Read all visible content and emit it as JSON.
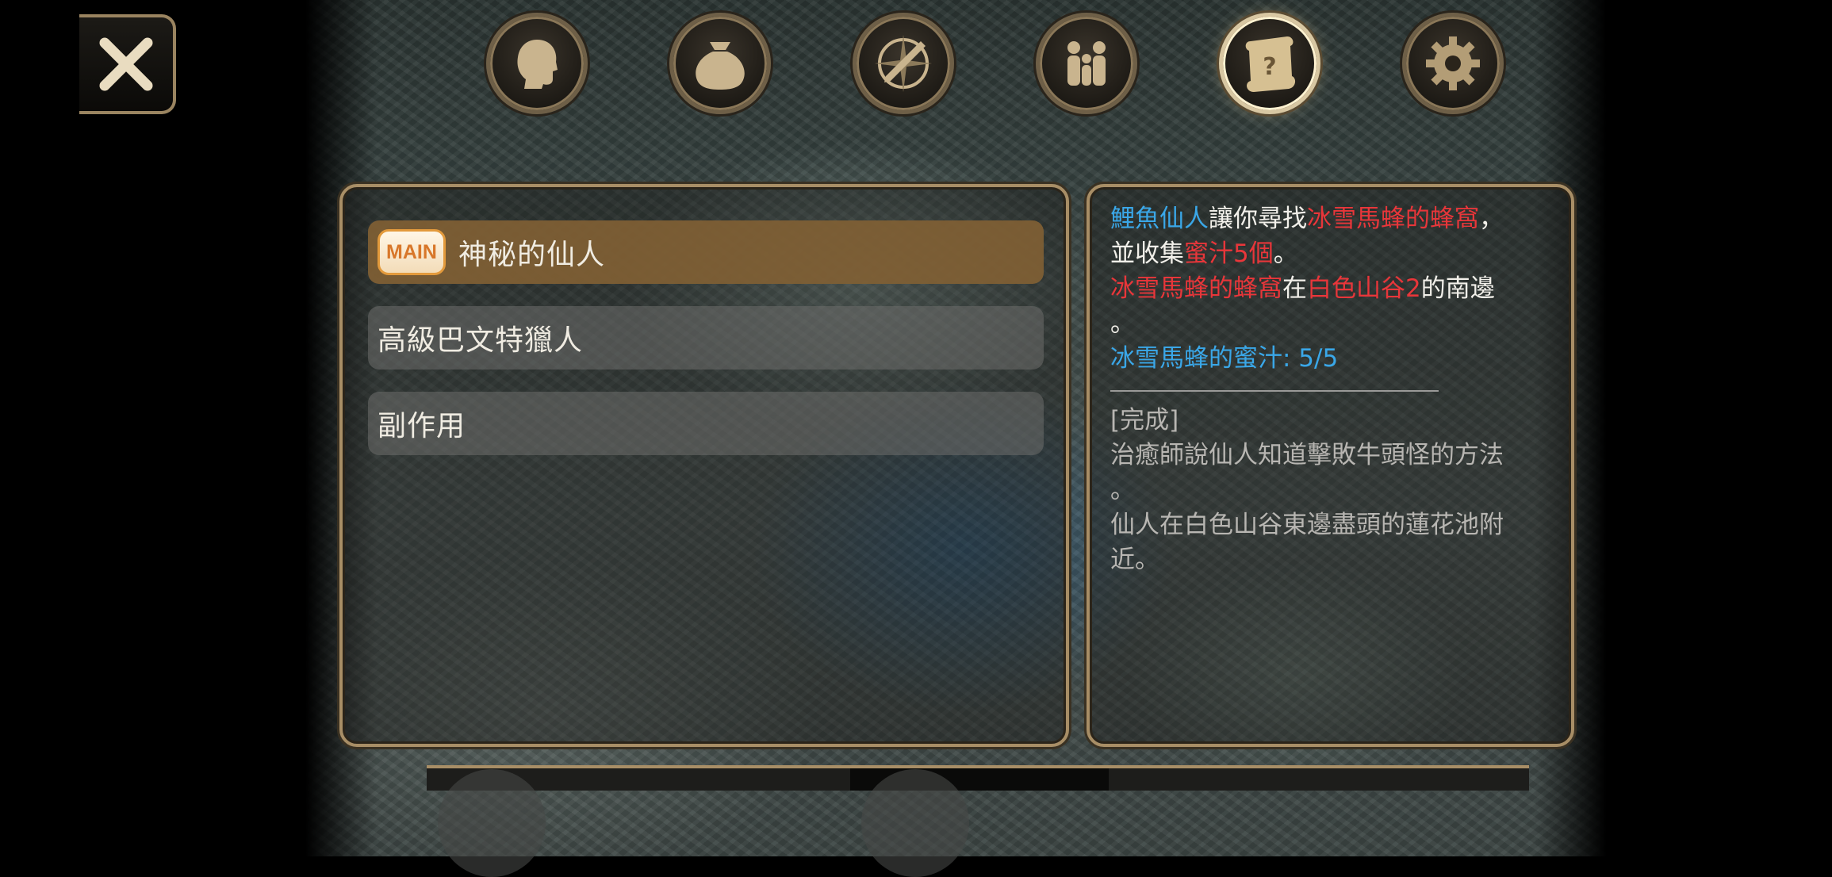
{
  "close_button": {
    "icon": "close-icon"
  },
  "menu": [
    {
      "name": "character",
      "icon": "head-icon",
      "active": false
    },
    {
      "name": "inventory",
      "icon": "bag-icon",
      "active": false
    },
    {
      "name": "skills",
      "icon": "compass-sword-icon",
      "active": false
    },
    {
      "name": "party",
      "icon": "people-icon",
      "active": false
    },
    {
      "name": "quests",
      "icon": "quest-scroll-icon",
      "active": true
    },
    {
      "name": "settings",
      "icon": "gear-icon",
      "active": false
    }
  ],
  "quests": [
    {
      "badge": "MAIN",
      "title": "神秘的仙人",
      "selected": true
    },
    {
      "badge": "",
      "title": "高級巴文特獵人",
      "selected": false
    },
    {
      "badge": "",
      "title": "副作用",
      "selected": false
    }
  ],
  "detail": {
    "line1_npc": "鯉魚仙人",
    "line1_mid": "讓你尋找",
    "line1_target": "冰雪馬蜂的蜂窩",
    "line1_end": "，",
    "line2_pre": "並收集",
    "line2_item": "蜜汁5個",
    "line2_end": "。",
    "line3_target": "冰雪馬蜂的蜂窩",
    "line3_mid": "在",
    "line3_place": "白色山谷2",
    "line3_end": "的南邊",
    "line4": "。",
    "progress": "冰雪馬蜂的蜜汁: 5/5",
    "done_label": "[完成]",
    "done_line1": "治癒師說仙人知道擊敗牛頭怪的方法",
    "done_line2": "。",
    "done_line3": "仙人在白色山谷東邊盡頭的蓮花池附",
    "done_line4": "近。"
  },
  "colors": {
    "highlight_blue": "#3aa7e8",
    "highlight_red": "#e8363a",
    "frame_gold": "#a88e66",
    "selected_row": "#806034"
  }
}
